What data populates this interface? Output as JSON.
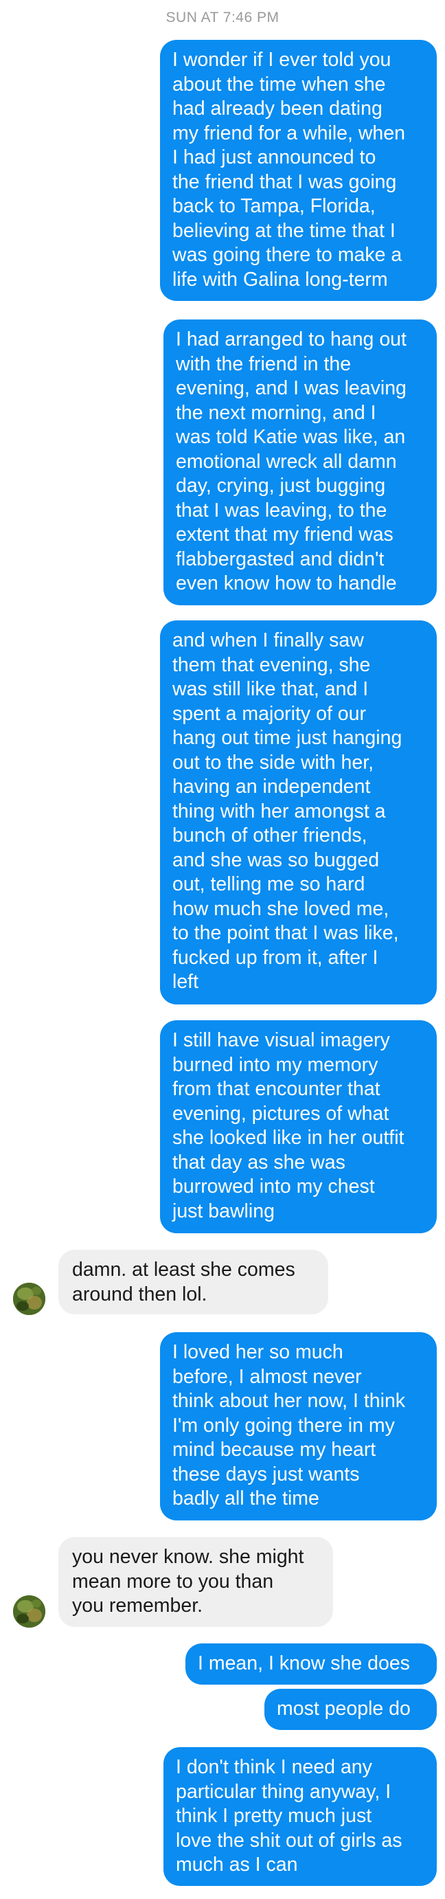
{
  "conversation": {
    "timestamp": "SUN AT 7:46 PM",
    "messages": [
      {
        "sender": "me",
        "text": "I wonder if I ever told you\nabout the time when she\nhad already been dating\nmy friend for a while, when\nI had just announced to\nthe friend that I was going\nback to Tampa, Florida,\nbelieving at the time that I\nwas going there to make a\nlife with Galina long-term"
      },
      {
        "sender": "me",
        "text": "I had arranged to hang out\nwith the friend in the\nevening, and I was leaving\nthe next morning, and I\nwas told Katie was like, an\nemotional wreck all damn\nday, crying, just bugging\nthat I was leaving, to the\nextent that my friend was\nflabbergasted and didn't\neven know how to handle"
      },
      {
        "sender": "me",
        "text": "and when I finally saw\nthem that evening, she\nwas still like that, and I\nspent a majority of our\nhang out time just hanging\nout to the side with her,\nhaving an independent\nthing with her amongst a\nbunch of other friends,\nand she was so bugged\nout, telling me so hard\nhow much she loved me,\nto the point that I was like,\nfucked up from it, after I\nleft"
      },
      {
        "sender": "me",
        "text": "I still have visual imagery\nburned into my memory\nfrom that encounter that\nevening, pictures of what\nshe looked like in her outfit\nthat day as she was\nburrowed into my chest\njust bawling"
      },
      {
        "sender": "them",
        "text": "damn. at least she comes\naround then lol."
      },
      {
        "sender": "me",
        "text": "I loved her so much\nbefore, I almost never\nthink about her now, I think\nI'm only going there in my\nmind because my heart\nthese days just wants\nbadly all the time"
      },
      {
        "sender": "them",
        "text": "you never know. she might\nmean more to you than\nyou remember."
      },
      {
        "sender": "me",
        "text": "I mean, I know she does"
      },
      {
        "sender": "me",
        "text": "most people do"
      },
      {
        "sender": "me",
        "text": "I don't think I need any\nparticular thing anyway, I\nthink I pretty much just\nlove the shit out of girls as\nmuch as I can"
      }
    ]
  },
  "contact": {
    "avatar_icon": "contact-avatar-photo"
  },
  "colors": {
    "outgoing_bubble": "#0a8cf0",
    "outgoing_text": "#ffffff",
    "incoming_bubble": "#efefef",
    "incoming_text": "#1a1a1a",
    "timestamp_text": "#9a9a9a"
  }
}
